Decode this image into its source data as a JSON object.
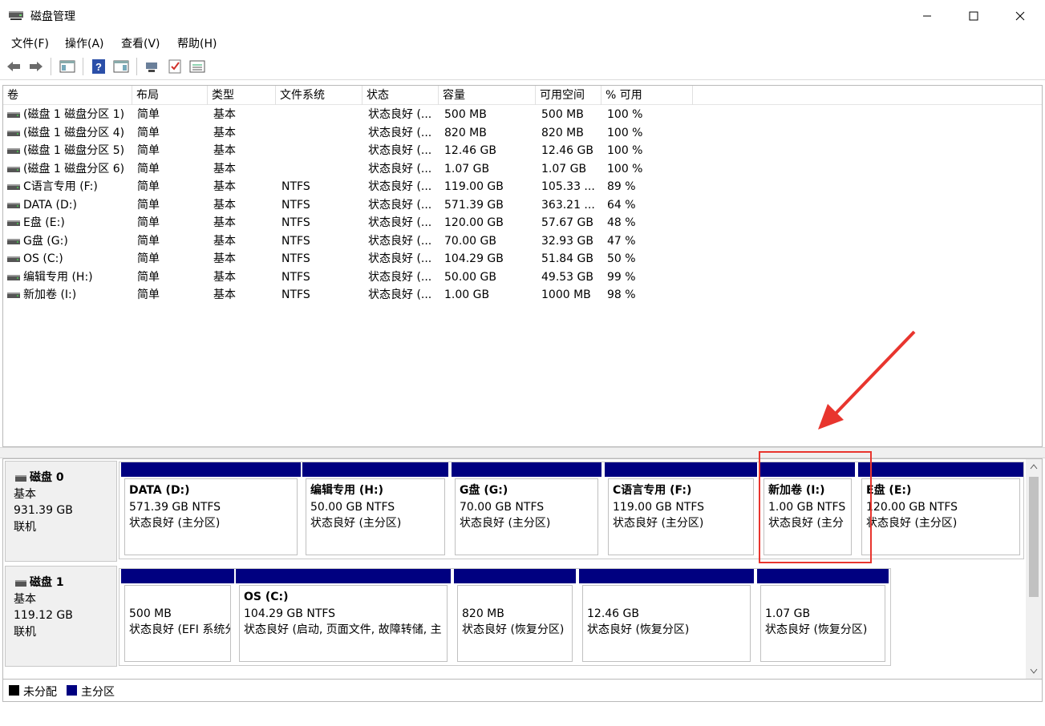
{
  "window": {
    "title": "磁盘管理"
  },
  "menu": [
    "文件(F)",
    "操作(A)",
    "查看(V)",
    "帮助(H)"
  ],
  "volume_list": {
    "columns": [
      "卷",
      "布局",
      "类型",
      "文件系统",
      "状态",
      "容量",
      "可用空间",
      "% 可用"
    ],
    "rows": [
      [
        "(磁盘 1 磁盘分区 1)",
        "简单",
        "基本",
        "",
        "状态良好 (...",
        "500 MB",
        "500 MB",
        "100 %"
      ],
      [
        "(磁盘 1 磁盘分区 4)",
        "简单",
        "基本",
        "",
        "状态良好 (...",
        "820 MB",
        "820 MB",
        "100 %"
      ],
      [
        "(磁盘 1 磁盘分区 5)",
        "简单",
        "基本",
        "",
        "状态良好 (...",
        "12.46 GB",
        "12.46 GB",
        "100 %"
      ],
      [
        "(磁盘 1 磁盘分区 6)",
        "简单",
        "基本",
        "",
        "状态良好 (...",
        "1.07 GB",
        "1.07 GB",
        "100 %"
      ],
      [
        "C语言专用 (F:)",
        "简单",
        "基本",
        "NTFS",
        "状态良好 (...",
        "119.00 GB",
        "105.33 ...",
        "89 %"
      ],
      [
        "DATA (D:)",
        "简单",
        "基本",
        "NTFS",
        "状态良好 (...",
        "571.39 GB",
        "363.21 ...",
        "64 %"
      ],
      [
        "E盘 (E:)",
        "简单",
        "基本",
        "NTFS",
        "状态良好 (...",
        "120.00 GB",
        "57.67 GB",
        "48 %"
      ],
      [
        "G盘 (G:)",
        "简单",
        "基本",
        "NTFS",
        "状态良好 (...",
        "70.00 GB",
        "32.93 GB",
        "47 %"
      ],
      [
        "OS (C:)",
        "简单",
        "基本",
        "NTFS",
        "状态良好 (...",
        "104.29 GB",
        "51.84 GB",
        "50 %"
      ],
      [
        "编辑专用 (H:)",
        "简单",
        "基本",
        "NTFS",
        "状态良好 (...",
        "50.00 GB",
        "49.53 GB",
        "99 %"
      ],
      [
        "新加卷 (I:)",
        "简单",
        "基本",
        "NTFS",
        "状态良好 (...",
        "1.00 GB",
        "1000 MB",
        "98 %"
      ]
    ]
  },
  "disks": [
    {
      "name": "磁盘 0",
      "type": "基本",
      "size": "931.39 GB",
      "status": "联机",
      "partitions": [
        {
          "name": "DATA  (D:)",
          "size": "571.39 GB NTFS",
          "status": "状态良好 (主分区)"
        },
        {
          "name": "编辑专用  (H:)",
          "size": "50.00 GB NTFS",
          "status": "状态良好 (主分区)"
        },
        {
          "name": "G盘  (G:)",
          "size": "70.00 GB NTFS",
          "status": "状态良好 (主分区)"
        },
        {
          "name": "C语言专用  (F:)",
          "size": "119.00 GB NTFS",
          "status": "状态良好 (主分区)"
        },
        {
          "name": "新加卷  (I:)",
          "size": "1.00 GB NTFS",
          "status": "状态良好 (主分"
        },
        {
          "name": "E盘  (E:)",
          "size": "120.00 GB NTFS",
          "status": "状态良好 (主分区)"
        }
      ]
    },
    {
      "name": "磁盘 1",
      "type": "基本",
      "size": "119.12 GB",
      "status": "联机",
      "partitions": [
        {
          "name": "",
          "size": "500 MB",
          "status": "状态良好 (EFI 系统分"
        },
        {
          "name": "OS  (C:)",
          "size": "104.29 GB NTFS",
          "status": "状态良好 (启动, 页面文件, 故障转储, 主"
        },
        {
          "name": "",
          "size": "820 MB",
          "status": "状态良好 (恢复分区)"
        },
        {
          "name": "",
          "size": "12.46 GB",
          "status": "状态良好 (恢复分区)"
        },
        {
          "name": "",
          "size": "1.07 GB",
          "status": "状态良好 (恢复分区)"
        }
      ]
    }
  ],
  "legend": [
    {
      "label": "未分配",
      "color": "#000000"
    },
    {
      "label": "主分区",
      "color": "#000080"
    }
  ],
  "colors": {
    "primary_partition": "#000080",
    "highlight": "#e8352e"
  },
  "icons": [
    "disk-management-icon",
    "back-icon",
    "forward-icon",
    "console-tree-icon",
    "help-icon",
    "properties-icon",
    "connect-icon",
    "check-icon",
    "list-icon",
    "drive-icon"
  ]
}
